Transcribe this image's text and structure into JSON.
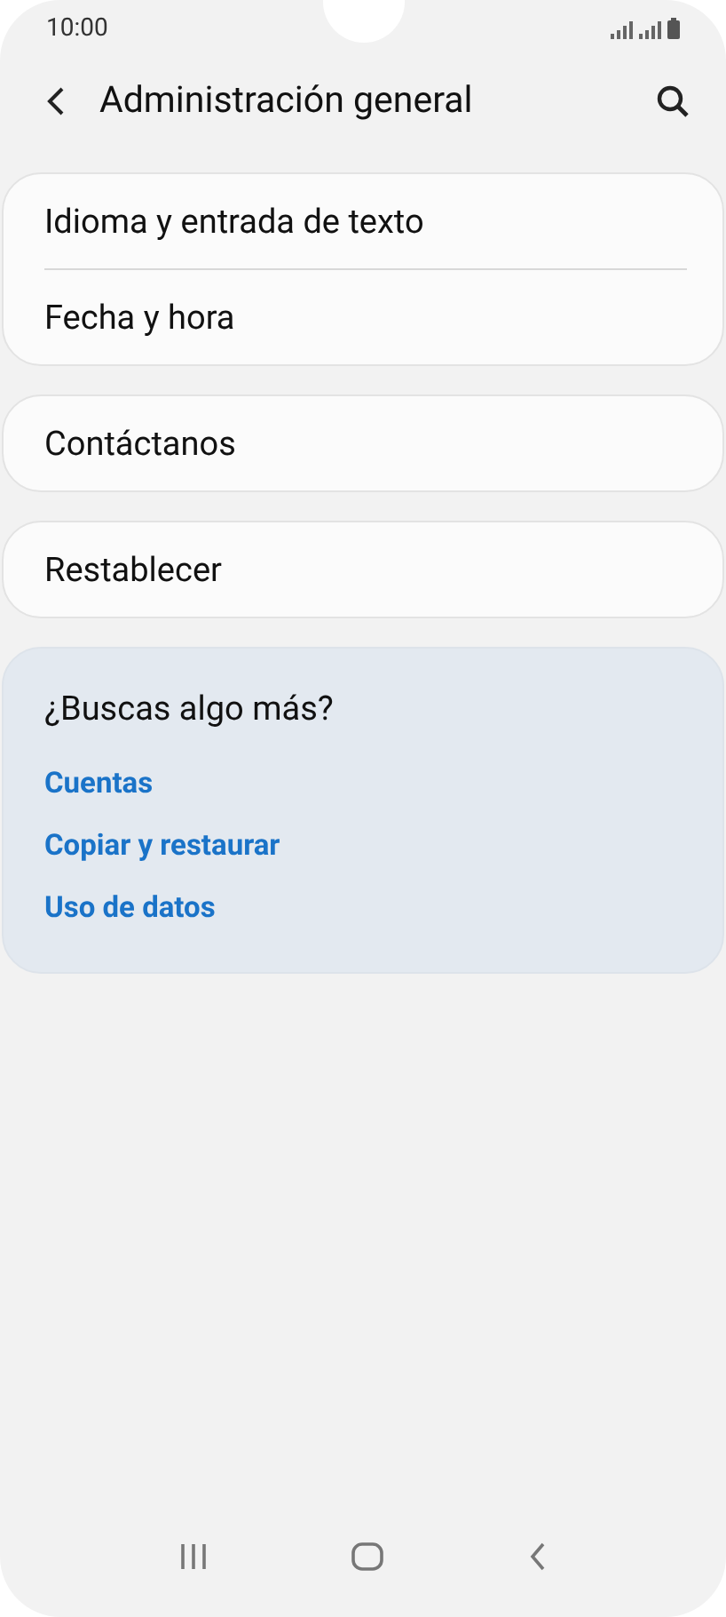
{
  "status_bar": {
    "time": "10:00"
  },
  "header": {
    "title": "Administración general"
  },
  "groups": [
    {
      "items": [
        {
          "label": "Idioma y entrada de texto"
        },
        {
          "label": "Fecha y hora"
        }
      ]
    },
    {
      "items": [
        {
          "label": "Contáctanos"
        }
      ]
    },
    {
      "items": [
        {
          "label": "Restablecer"
        }
      ]
    }
  ],
  "suggestions": {
    "title": "¿Buscas algo más?",
    "links": [
      "Cuentas",
      "Copiar y restaurar",
      "Uso de datos"
    ]
  }
}
